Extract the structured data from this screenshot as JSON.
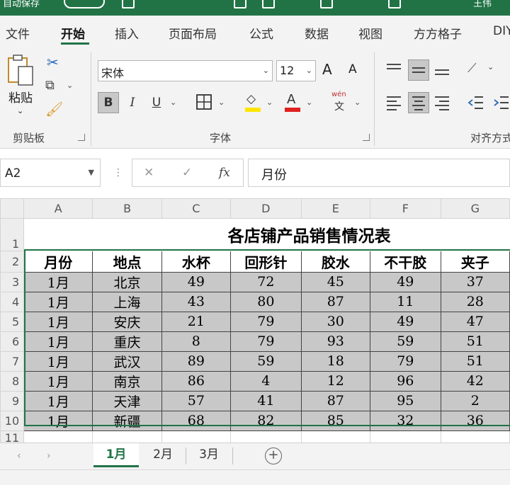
{
  "titlebar": {
    "autosave_label": "自动保存",
    "username": "王伟"
  },
  "ribbon_tabs": [
    "文件",
    "开始",
    "插入",
    "页面布局",
    "公式",
    "数据",
    "视图",
    "方方格子",
    "DIY"
  ],
  "clipboard": {
    "paste_label": "粘贴",
    "group_label": "剪贴板"
  },
  "font_group": {
    "font_name": "宋体",
    "font_size": "12",
    "group_label": "字体",
    "bold": "B",
    "italic": "I",
    "underline": "U",
    "grow": "A",
    "shrink": "A",
    "font_color": "A",
    "phonetic": "wén"
  },
  "alignment_group": {
    "group_label": "对齐方式"
  },
  "formula_bar": {
    "name_box": "A2",
    "formula": "月份"
  },
  "columns": [
    "A",
    "B",
    "C",
    "D",
    "E",
    "F",
    "G"
  ],
  "rows": [
    "1",
    "2",
    "3",
    "4",
    "5",
    "6",
    "7",
    "8",
    "9",
    "10",
    "11"
  ],
  "sheet": {
    "title": "各店铺产品销售情况表",
    "headers": [
      "月份",
      "地点",
      "水杯",
      "回形针",
      "胶水",
      "不干胶",
      "夹子"
    ],
    "data": [
      [
        "1月",
        "北京",
        "49",
        "72",
        "45",
        "49",
        "37"
      ],
      [
        "1月",
        "上海",
        "43",
        "80",
        "87",
        "11",
        "28"
      ],
      [
        "1月",
        "安庆",
        "21",
        "79",
        "30",
        "49",
        "47"
      ],
      [
        "1月",
        "重庆",
        "8",
        "79",
        "93",
        "59",
        "51"
      ],
      [
        "1月",
        "武汉",
        "89",
        "59",
        "18",
        "79",
        "51"
      ],
      [
        "1月",
        "南京",
        "86",
        "4",
        "12",
        "96",
        "42"
      ],
      [
        "1月",
        "天津",
        "57",
        "41",
        "87",
        "95",
        "2"
      ],
      [
        "1月",
        "新疆",
        "68",
        "82",
        "85",
        "32",
        "36"
      ]
    ]
  },
  "sheet_tabs": [
    "1月",
    "2月",
    "3月"
  ],
  "colors": {
    "accent": "#217346",
    "data_fill": "#c8c8c8"
  }
}
